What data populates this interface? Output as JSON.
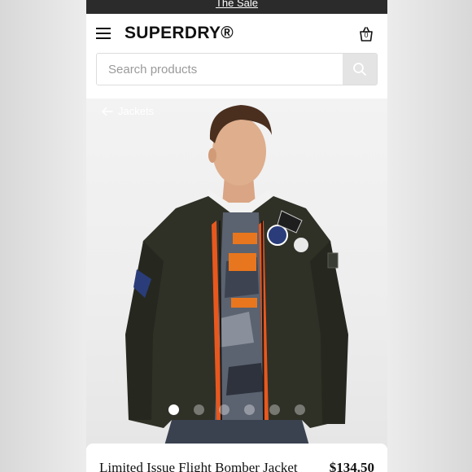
{
  "promo": {
    "text": "The Sale"
  },
  "header": {
    "logo": "SUPERDRY®",
    "basket_count": "0"
  },
  "search": {
    "placeholder": "Search products"
  },
  "breadcrumb": {
    "label": "Jackets"
  },
  "gallery": {
    "slide_count": 6,
    "active_index": 0
  },
  "product": {
    "name": "Limited Issue Flight Bomber Jacket",
    "price": "$134.50"
  },
  "colors": {
    "promo_bg": "#2b2b2b",
    "jacket": "#2f3127",
    "lining": "#e8581e"
  },
  "icons": [
    "menu-icon",
    "basket-icon",
    "search-icon",
    "arrow-left-icon"
  ]
}
